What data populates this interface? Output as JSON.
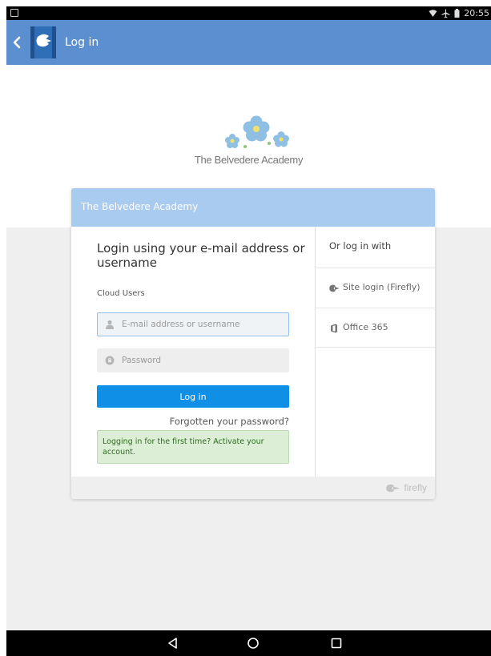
{
  "status_bar": {
    "time": "20:55",
    "icons": [
      "image-icon",
      "wifi-icon",
      "airplane-icon",
      "battery-icon"
    ]
  },
  "app_bar": {
    "title": "Log in",
    "back_icon": "chevron-left-icon",
    "color": "#5c8fcf"
  },
  "school": {
    "name": "The Belvedere Academy",
    "logo_icon": "forget-me-not-flowers-logo"
  },
  "card": {
    "header_title": "The Belvedere Academy",
    "header_color": "#a9cbef",
    "login_heading": "Login using your e-mail address or username",
    "section_label": "Cloud Users",
    "email_placeholder": "E-mail address or username",
    "password_placeholder": "Password",
    "login_button": "Log in",
    "login_button_color": "#0f8fe6",
    "forgot_password": "Forgotten your password?",
    "activate_message": "Logging in for the first time? Activate your account.",
    "alt_heading": "Or log in with",
    "alt_options": [
      {
        "label": "Site login (Firefly)",
        "icon": "firefly-logo-icon"
      },
      {
        "label": "Office 365",
        "icon": "office-365-icon"
      }
    ],
    "footer_brand": "firefly"
  },
  "nav_bar": {
    "buttons": [
      "back-triangle-icon",
      "home-circle-icon",
      "recents-square-icon"
    ]
  }
}
